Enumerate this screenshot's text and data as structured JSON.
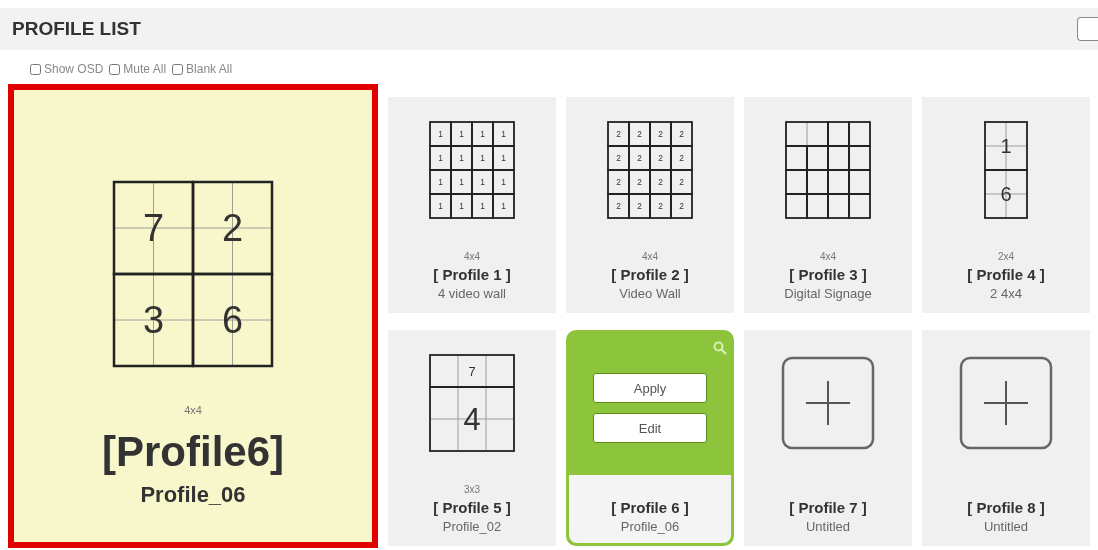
{
  "header": {
    "title": "PROFILE LIST"
  },
  "options": [
    {
      "label": "Show OSD",
      "checked": false
    },
    {
      "label": "Mute All",
      "checked": false
    },
    {
      "label": "Blank All",
      "checked": false
    }
  ],
  "preview": {
    "size": "4x4",
    "title": "[Profile6]",
    "subtitle": "Profile_06",
    "diagram": {
      "kind": "quad",
      "screens": [
        "7",
        "2",
        "3",
        "6"
      ]
    }
  },
  "profiles": [
    {
      "kind": "layout",
      "hovered": false,
      "size": "4x4",
      "title": "[ Profile 1 ]",
      "subtitle": "4 video wall",
      "diagram": {
        "kind": "uniform",
        "screens": [
          "1",
          "1",
          "1",
          "1",
          "1",
          "1",
          "1",
          "1",
          "1",
          "1",
          "1",
          "1",
          "1",
          "1",
          "1",
          "1"
        ]
      }
    },
    {
      "kind": "layout",
      "hovered": false,
      "size": "4x4",
      "title": "[ Profile 2 ]",
      "subtitle": "Video Wall",
      "diagram": {
        "kind": "uniform",
        "screens": [
          "2",
          "2",
          "2",
          "2",
          "2",
          "2",
          "2",
          "2",
          "2",
          "2",
          "2",
          "2",
          "2",
          "2",
          "2",
          "2"
        ]
      }
    },
    {
      "kind": "layout",
      "hovered": false,
      "size": "4x4",
      "title": "[ Profile 3 ]",
      "subtitle": "Digital Signage",
      "diagram": {
        "kind": "signage"
      }
    },
    {
      "kind": "layout",
      "hovered": false,
      "size": "2x4",
      "title": "[ Profile 4 ]",
      "subtitle": "2 4x4",
      "diagram": {
        "kind": "stack",
        "screens": [
          "1",
          "6"
        ]
      }
    },
    {
      "kind": "layout",
      "hovered": false,
      "size": "3x3",
      "title": "[ Profile 5 ]",
      "subtitle": "Profile_02",
      "diagram": {
        "kind": "strip",
        "screens": [
          "7",
          "4"
        ]
      }
    },
    {
      "hovered": true,
      "title": "[ Profile 6 ]",
      "subtitle": "Profile_06",
      "actions": [
        "Apply",
        "Edit"
      ]
    },
    {
      "kind": "empty",
      "hovered": false,
      "title": "[ Profile 7 ]",
      "subtitle": "Untitled"
    },
    {
      "kind": "empty",
      "hovered": false,
      "title": "[ Profile 8 ]",
      "subtitle": "Untitled"
    }
  ]
}
